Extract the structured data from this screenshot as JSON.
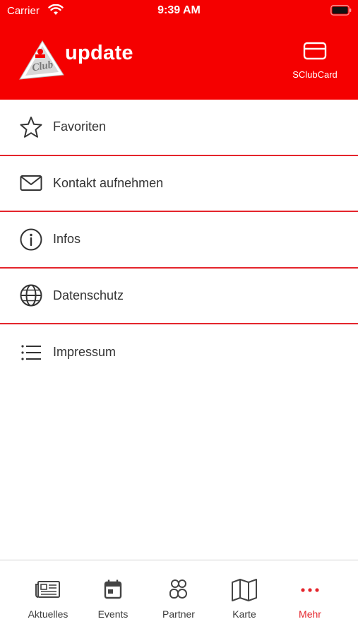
{
  "status_bar": {
    "carrier": "Carrier",
    "time": "9:39 AM"
  },
  "header": {
    "logo_text": "Club",
    "title": "update",
    "card_button_label": "SClubCard",
    "card_icon": "credit-card-icon"
  },
  "menu": {
    "items": [
      {
        "label": "Favoriten",
        "icon": "star-icon"
      },
      {
        "label": "Kontakt aufnehmen",
        "icon": "mail-icon"
      },
      {
        "label": "Infos",
        "icon": "info-icon"
      },
      {
        "label": "Datenschutz",
        "icon": "globe-icon"
      },
      {
        "label": "Impressum",
        "icon": "list-icon"
      }
    ]
  },
  "tabbar": {
    "tabs": [
      {
        "label": "Aktuelles",
        "icon": "newspaper-icon",
        "active": false
      },
      {
        "label": "Events",
        "icon": "calendar-icon",
        "active": false
      },
      {
        "label": "Partner",
        "icon": "partner-icon",
        "active": false
      },
      {
        "label": "Karte",
        "icon": "map-icon",
        "active": false
      },
      {
        "label": "Mehr",
        "icon": "more-icon",
        "active": true
      }
    ]
  },
  "colors": {
    "brand_red": "#f50000",
    "divider_red": "#e4252c",
    "active_tab": "#e4252c",
    "text": "#333333"
  }
}
